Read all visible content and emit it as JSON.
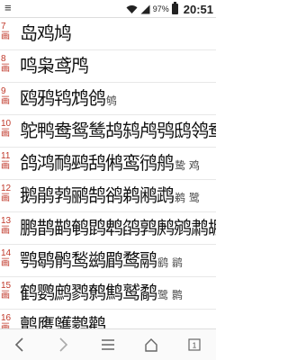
{
  "status": {
    "menu_glyph": "≡",
    "battery_text": "97%",
    "battery_level": 0.97,
    "time": "20:51"
  },
  "rows": [
    {
      "num": "7",
      "unit": "画",
      "chars": "岛鸡鸠",
      "extra": ""
    },
    {
      "num": "8",
      "unit": "画",
      "chars": "鸣枭鸢鸤",
      "extra": ""
    },
    {
      "num": "9",
      "unit": "画",
      "chars": "鸥鸦鸨鸩鸧",
      "extra": "鸲"
    },
    {
      "num": "10",
      "unit": "画",
      "chars": "鸵鸭鸯鸳鸶鸪鸫鸬鸮鸱鸰鸯",
      "extra": ""
    },
    {
      "num": "11",
      "unit": "画",
      "chars": "鸽鸿鸸鹀鸹鸺鸾鸻鸼",
      "extra": "鸷 鸡"
    },
    {
      "num": "12",
      "unit": "画",
      "chars": "鹅鹃鹁鹂鹄鹆鹈鹇鹉",
      "extra": "鹈 鹭"
    },
    {
      "num": "13",
      "unit": "画",
      "chars": "鹏鹊鹋鹌鹍鹎鹐鹑鹒鹓鹔鹕",
      "extra": ""
    },
    {
      "num": "14",
      "unit": "画",
      "chars": "鹗鹖鹘鹙鹚鹛鹜鹝",
      "extra": "鹞 鹟"
    },
    {
      "num": "15",
      "unit": "画",
      "chars": "鹤鹦鹧鹨鹩鹪鹫鹬",
      "extra": "鹭 鹮"
    },
    {
      "num": "16",
      "unit": "画",
      "chars": "鹯鹰鹱鹲鹳",
      "extra": ""
    }
  ],
  "nav": {
    "back_icon": "chevron-left",
    "forward_icon": "chevron-right",
    "menu_icon": "hamburger",
    "home_icon": "home",
    "tabs_count": "1"
  }
}
